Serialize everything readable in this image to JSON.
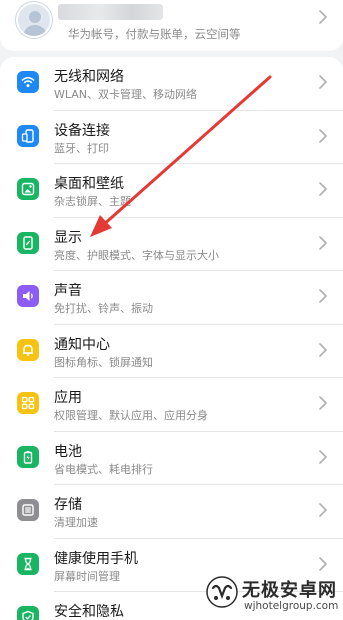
{
  "account": {
    "subtitle": "华为帐号，付款与账单，云空间等"
  },
  "settings": [
    {
      "title": "无线和网络",
      "subtitle": "WLAN、双卡管理、移动网络",
      "icon": "wifi-icon",
      "color": "#1e88f5"
    },
    {
      "title": "设备连接",
      "subtitle": "蓝牙、打印",
      "icon": "device-connection-icon",
      "color": "#1e88f5"
    },
    {
      "title": "桌面和壁纸",
      "subtitle": "杂志锁屏、主题",
      "icon": "wallpaper-icon",
      "color": "#19b562"
    },
    {
      "title": "显示",
      "subtitle": "亮度、护眼模式、字体与显示大小",
      "icon": "display-icon",
      "color": "#19b562"
    },
    {
      "title": "声音",
      "subtitle": "免打扰、铃声、振动",
      "icon": "sound-icon",
      "color": "#8b5cf6"
    },
    {
      "title": "通知中心",
      "subtitle": "图标角标、锁屏通知",
      "icon": "bell-icon",
      "color": "#f7c313"
    },
    {
      "title": "应用",
      "subtitle": "权限管理、默认应用、应用分身",
      "icon": "apps-grid-icon",
      "color": "#f7c313"
    },
    {
      "title": "电池",
      "subtitle": "省电模式、耗电排行",
      "icon": "battery-icon",
      "color": "#19b562"
    },
    {
      "title": "存储",
      "subtitle": "清理加速",
      "icon": "storage-icon",
      "color": "#8e8e93"
    },
    {
      "title": "健康使用手机",
      "subtitle": "屏幕时间管理",
      "icon": "hourglass-icon",
      "color": "#19b562"
    },
    {
      "title": "安全和隐私",
      "subtitle": "",
      "icon": "shield-icon",
      "color": "#19b562"
    }
  ],
  "watermark": {
    "title": "无极安卓网",
    "url": "wjhotelgroup.com"
  },
  "colors": {
    "annotation_arrow": "#e53935"
  }
}
